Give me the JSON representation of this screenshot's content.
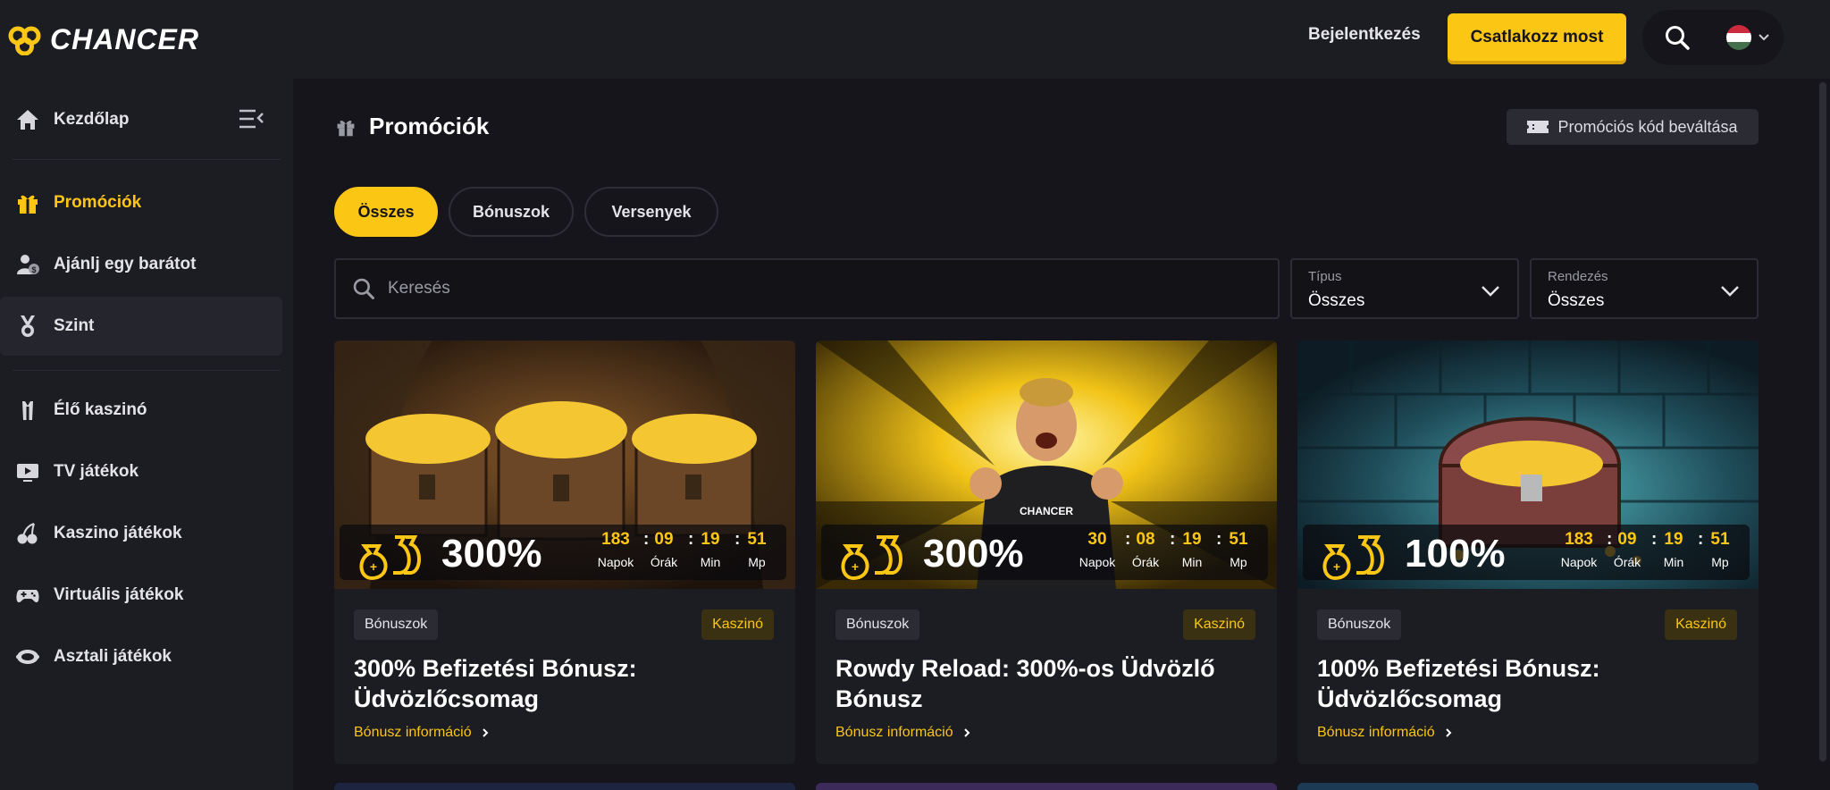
{
  "header": {
    "logo_text": "CHANCER",
    "login_label": "Bejelentkezés",
    "join_label": "Csatlakozz most"
  },
  "sidebar": {
    "items": [
      {
        "label": "Kezdőlap"
      },
      {
        "label": "Promóciók"
      },
      {
        "label": "Ajánlj egy barátot"
      },
      {
        "label": "Szint"
      },
      {
        "label": "Élő kaszinó"
      },
      {
        "label": "TV játékok"
      },
      {
        "label": "Kaszino játékok"
      },
      {
        "label": "Virtuális játékok"
      },
      {
        "label": "Asztali játékok"
      }
    ]
  },
  "page": {
    "title": "Promóciók",
    "promo_code_label": "Promóciós kód beváltása"
  },
  "filters": {
    "chips": [
      {
        "label": "Összes"
      },
      {
        "label": "Bónuszok"
      },
      {
        "label": "Versenyek"
      }
    ],
    "search_placeholder": "Keresés",
    "type": {
      "label": "Típus",
      "value": "Összes"
    },
    "sort": {
      "label": "Rendezés",
      "value": "Összes"
    }
  },
  "cards": [
    {
      "percent": "300%",
      "timer": {
        "d": "183",
        "h": "09",
        "m": "19",
        "s": "51"
      },
      "timer_labels": {
        "d": "Napok",
        "h": "Órák",
        "m": "Min",
        "s": "Mp"
      },
      "tag_left": "Bónuszok",
      "tag_right": "Kaszinó",
      "title": "300% Befizetési Bónusz: Üdvözlőcsomag",
      "link": "Bónusz információ"
    },
    {
      "percent": "300%",
      "timer": {
        "d": "30",
        "h": "08",
        "m": "19",
        "s": "51"
      },
      "timer_labels": {
        "d": "Napok",
        "h": "Órák",
        "m": "Min",
        "s": "Mp"
      },
      "tag_left": "Bónuszok",
      "tag_right": "Kaszinó",
      "title": "Rowdy Reload: 300%-os Üdvözlő Bónusz",
      "link": "Bónusz információ"
    },
    {
      "percent": "100%",
      "timer": {
        "d": "183",
        "h": "09",
        "m": "19",
        "s": "51"
      },
      "timer_labels": {
        "d": "Napok",
        "h": "Órák",
        "m": "Min",
        "s": "Mp"
      },
      "tag_left": "Bónuszok",
      "tag_right": "Kaszinó",
      "title": "100% Befizetési Bónusz: Üdvözlőcsomag",
      "link": "Bónusz információ"
    }
  ],
  "colors": {
    "accent": "#fcc614",
    "background": "#15151b",
    "panel": "#1c1c23"
  },
  "icons": [
    "home-icon",
    "gift-icon",
    "refer-friend-icon",
    "level-medal-icon",
    "live-casino-icon",
    "tv-icon",
    "cherries-icon",
    "gamepad-icon",
    "table-games-icon",
    "search-icon",
    "chevron-down-icon",
    "ticket-icon",
    "money-bags-icon",
    "sidebar-collapse-icon"
  ]
}
